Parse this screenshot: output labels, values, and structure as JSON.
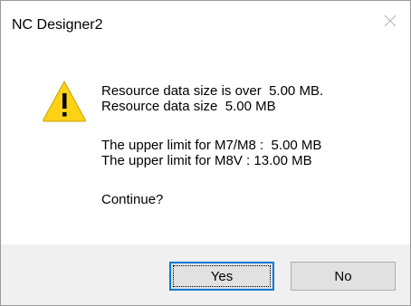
{
  "window": {
    "title": "NC Designer2"
  },
  "icons": {
    "warning": "warning-icon",
    "close": "close-icon"
  },
  "message": {
    "line1": "Resource data size is over  5.00 MB.",
    "line2": "Resource data size  5.00 MB",
    "line3": "The upper limit for M7/M8 :  5.00 MB",
    "line4": "The upper limit for M8V : 13.00 MB",
    "line5": "Continue?"
  },
  "buttons": {
    "yes_label": "Yes",
    "no_label": "No"
  },
  "colors": {
    "accent": "#0078d7",
    "warning_fill": "#fcd116",
    "footer": "#f0f0f0"
  }
}
